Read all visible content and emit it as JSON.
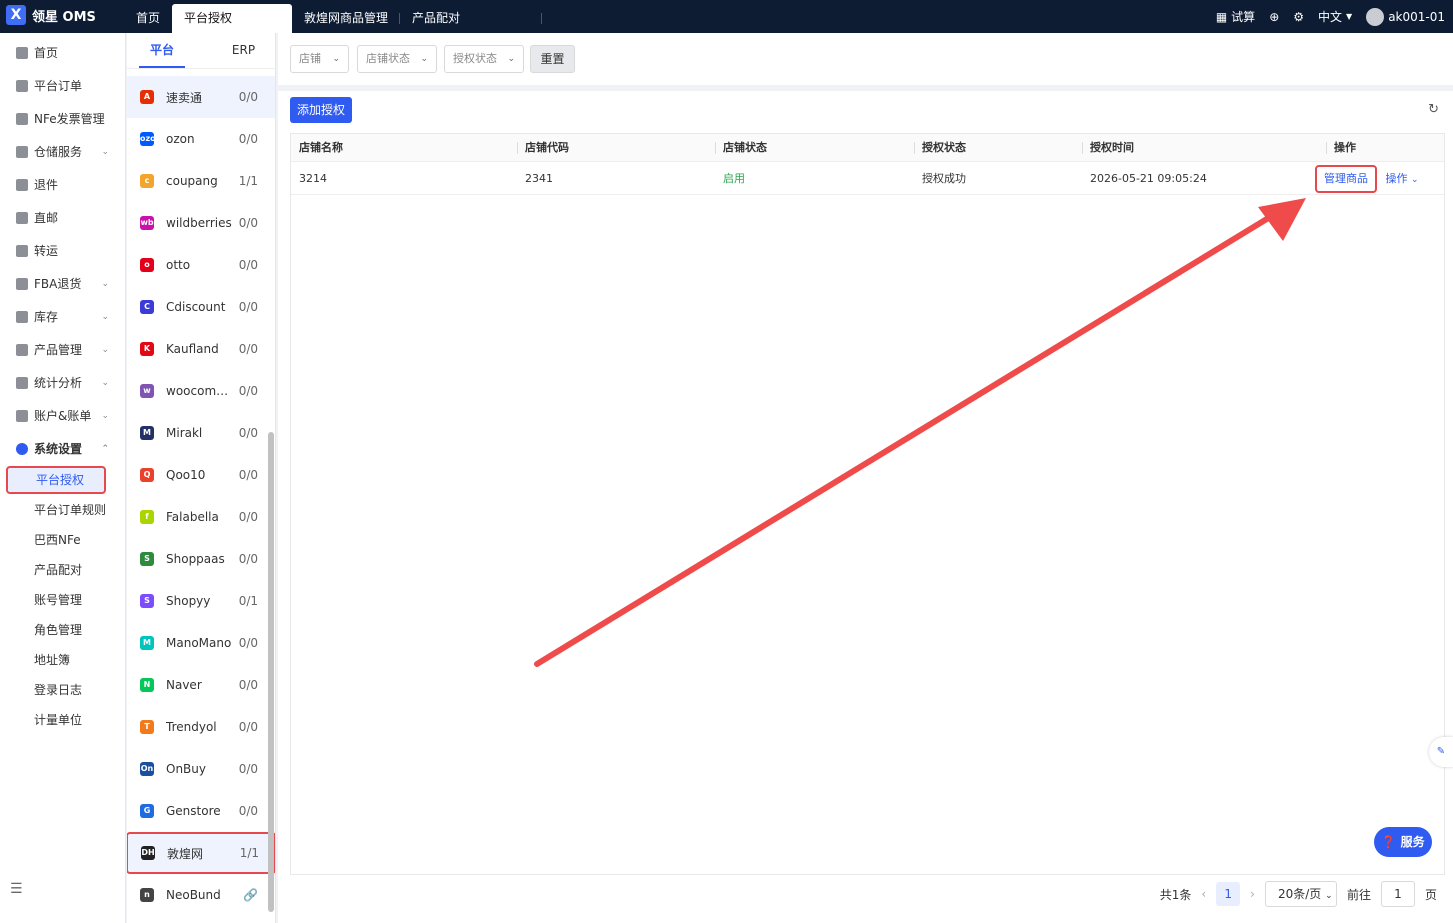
{
  "app": {
    "title": "领星 OMS"
  },
  "topnav": {
    "tabs": [
      "首页",
      "平台授权",
      "敦煌网商品管理",
      "产品配对"
    ],
    "trial": "试算",
    "lang": "中文",
    "user": "ak001-01"
  },
  "sidebar": {
    "items": [
      {
        "label": "首页",
        "chev": ""
      },
      {
        "label": "平台订单",
        "chev": ""
      },
      {
        "label": "NFe发票管理",
        "chev": ""
      },
      {
        "label": "仓储服务",
        "chev": "⌄"
      },
      {
        "label": "退件",
        "chev": ""
      },
      {
        "label": "直邮",
        "chev": ""
      },
      {
        "label": "转运",
        "chev": ""
      },
      {
        "label": "FBA退货",
        "chev": "⌄"
      },
      {
        "label": "库存",
        "chev": "⌄"
      },
      {
        "label": "产品管理",
        "chev": "⌄"
      },
      {
        "label": "统计分析",
        "chev": "⌄"
      },
      {
        "label": "账户&账单",
        "chev": "⌄"
      }
    ],
    "section": {
      "label": "系统设置",
      "chev": "⌃"
    },
    "sub": [
      "平台授权",
      "平台订单规则",
      "巴西NFe",
      "产品配对",
      "账号管理",
      "角色管理",
      "地址簿",
      "登录日志",
      "计量单位"
    ]
  },
  "platform": {
    "tabs": [
      "平台",
      "ERP"
    ],
    "list": [
      {
        "name": "速卖通",
        "count": "0/0",
        "color": "#e62e04",
        "glyph": "A"
      },
      {
        "name": "ozon",
        "count": "0/0",
        "color": "#005bff",
        "glyph": "ozon"
      },
      {
        "name": "coupang",
        "count": "1/1",
        "color": "#f3a52b",
        "glyph": "c"
      },
      {
        "name": "wildberries",
        "count": "0/0",
        "color": "#cb11ab",
        "glyph": "wb"
      },
      {
        "name": "otto",
        "count": "0/0",
        "color": "#e3001b",
        "glyph": "o"
      },
      {
        "name": "Cdiscount",
        "count": "0/0",
        "color": "#3b3bd8",
        "glyph": "C"
      },
      {
        "name": "Kaufland",
        "count": "0/0",
        "color": "#e10915",
        "glyph": "K"
      },
      {
        "name": "woocommerce",
        "count": "0/0",
        "color": "#7f54b3",
        "glyph": "w"
      },
      {
        "name": "Mirakl",
        "count": "0/0",
        "color": "#233167",
        "glyph": "M"
      },
      {
        "name": "Qoo10",
        "count": "0/0",
        "color": "#e8412c",
        "glyph": "Q"
      },
      {
        "name": "Falabella",
        "count": "0/0",
        "color": "#aad500",
        "glyph": "f"
      },
      {
        "name": "Shoppaas",
        "count": "0/0",
        "color": "#2e8b3d",
        "glyph": "S"
      },
      {
        "name": "Shopyy",
        "count": "0/1",
        "color": "#7c4dff",
        "glyph": "S"
      },
      {
        "name": "ManoMano",
        "count": "0/0",
        "color": "#00c5bc",
        "glyph": "M"
      },
      {
        "name": "Naver",
        "count": "0/0",
        "color": "#03c75a",
        "glyph": "N"
      },
      {
        "name": "Trendyol",
        "count": "0/0",
        "color": "#f27a1a",
        "glyph": "T"
      },
      {
        "name": "OnBuy",
        "count": "0/0",
        "color": "#1a4fa0",
        "glyph": "On"
      },
      {
        "name": "Genstore",
        "count": "0/0",
        "color": "#1e6ce0",
        "glyph": "G"
      },
      {
        "name": "敦煌网",
        "count": "1/1",
        "color": "#222222",
        "glyph": "DH"
      },
      {
        "name": "NeoBund",
        "count": "🔗",
        "color": "#444444",
        "glyph": "n"
      }
    ]
  },
  "filters": {
    "shop": "店铺",
    "shop_status": "店铺状态",
    "auth_status": "授权状态",
    "reset": "重置"
  },
  "toolbar": {
    "add": "添加授权"
  },
  "table": {
    "headers": [
      "店铺名称",
      "店铺代码",
      "店铺状态",
      "授权状态",
      "授权时间",
      "操作"
    ],
    "rows": [
      {
        "name": "3214",
        "code": "2341",
        "status": "启用",
        "auth": "授权成功",
        "time": "2026-05-21 09:05:24",
        "manage": "管理商品",
        "op": "操作"
      }
    ]
  },
  "pager": {
    "total": "共1条",
    "page": "1",
    "size": "20条/页",
    "goto": "前往",
    "goto_val": "1",
    "unit": "页"
  },
  "service": {
    "label": "服务"
  },
  "colors": {
    "accent": "#2f5bf0",
    "highlight": "#e5484d",
    "topbar": "#0d1b33"
  }
}
